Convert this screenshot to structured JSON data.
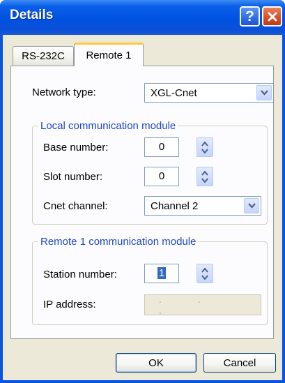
{
  "window": {
    "title": "Details"
  },
  "titlebar": {
    "help_icon": "question-icon",
    "close_icon": "close-icon"
  },
  "tabs": [
    {
      "label": "RS-232C",
      "selected": false
    },
    {
      "label": "Remote 1",
      "selected": true
    }
  ],
  "network": {
    "label": "Network type:",
    "value": "XGL-Cnet"
  },
  "local_module": {
    "legend": "Local communication module",
    "base_label": "Base number:",
    "base_value": "0",
    "slot_label": "Slot number:",
    "slot_value": "0",
    "channel_label": "Cnet channel:",
    "channel_value": "Channel 2"
  },
  "remote_module": {
    "legend": "Remote 1 communication module",
    "station_label": "Station number:",
    "station_value": "1",
    "ip_label": "IP address:",
    "ip_value": ". . ."
  },
  "buttons": {
    "ok": "OK",
    "cancel": "Cancel"
  },
  "colors": {
    "titlebar": "#0A54E2",
    "dialog_bg": "#ECE9D8",
    "legend_text": "#1E46C8",
    "close_button": "#D64B25"
  }
}
